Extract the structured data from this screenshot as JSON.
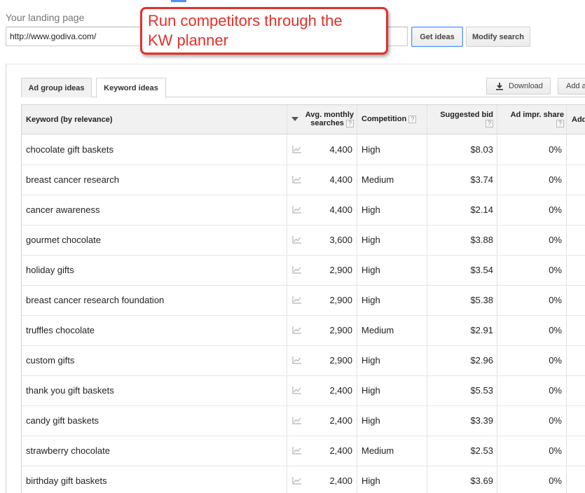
{
  "header": {
    "landing_page_label": "Your landing page",
    "url_value": "http://www.godiva.com/",
    "get_ideas_label": "Get ideas",
    "modify_search_label": "Modify search"
  },
  "annotation": {
    "line1": "Run competitors through the",
    "line2": "KW planner",
    "color": "#e4302a"
  },
  "tabs": [
    {
      "label": "Ad group ideas",
      "active": false
    },
    {
      "label": "Keyword ideas",
      "active": true
    }
  ],
  "toolbar": {
    "download_label": "Download",
    "add_label": "Add a"
  },
  "table": {
    "columns": {
      "keyword": "Keyword (by relevance)",
      "avg_line1": "Avg. monthly",
      "avg_line2": "searches",
      "competition": "Competition",
      "bid_line1": "Suggested bid",
      "impr_line1": "Ad impr. share",
      "add": "Add",
      "help_glyph": "?"
    },
    "rows": [
      {
        "keyword": "chocolate gift baskets",
        "avg": "4,400",
        "competition": "High",
        "bid": "$8.03",
        "impr": "0%"
      },
      {
        "keyword": "breast cancer research",
        "avg": "4,400",
        "competition": "Medium",
        "bid": "$3.74",
        "impr": "0%"
      },
      {
        "keyword": "cancer awareness",
        "avg": "4,400",
        "competition": "High",
        "bid": "$2.14",
        "impr": "0%"
      },
      {
        "keyword": "gourmet chocolate",
        "avg": "3,600",
        "competition": "High",
        "bid": "$3.88",
        "impr": "0%"
      },
      {
        "keyword": "holiday gifts",
        "avg": "2,900",
        "competition": "High",
        "bid": "$3.54",
        "impr": "0%"
      },
      {
        "keyword": "breast cancer research foundation",
        "avg": "2,900",
        "competition": "High",
        "bid": "$5.38",
        "impr": "0%"
      },
      {
        "keyword": "truffles chocolate",
        "avg": "2,900",
        "competition": "Medium",
        "bid": "$2.91",
        "impr": "0%"
      },
      {
        "keyword": "custom gifts",
        "avg": "2,900",
        "competition": "High",
        "bid": "$2.96",
        "impr": "0%"
      },
      {
        "keyword": "thank you gift baskets",
        "avg": "2,400",
        "competition": "High",
        "bid": "$5.53",
        "impr": "0%"
      },
      {
        "keyword": "candy gift baskets",
        "avg": "2,400",
        "competition": "High",
        "bid": "$3.39",
        "impr": "0%"
      },
      {
        "keyword": "strawberry chocolate",
        "avg": "2,400",
        "competition": "Medium",
        "bid": "$2.53",
        "impr": "0%"
      },
      {
        "keyword": "birthday gift baskets",
        "avg": "2,400",
        "competition": "High",
        "bid": "$3.69",
        "impr": "0%"
      }
    ],
    "trend_icon": "line-chart-icon",
    "sort_icon": "sort-desc-icon"
  }
}
